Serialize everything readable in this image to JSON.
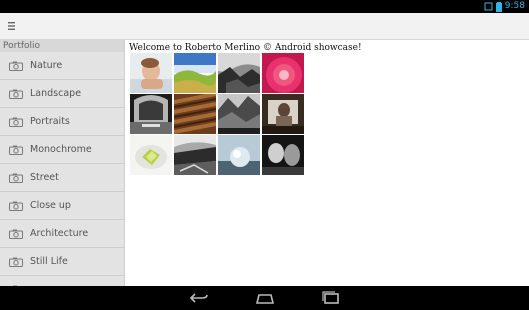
{
  "status": {
    "time": "9:58"
  },
  "sidebar": {
    "header": "Portfolio",
    "items": [
      {
        "label": "Nature"
      },
      {
        "label": "Landscape"
      },
      {
        "label": "Portraits"
      },
      {
        "label": "Monochrome"
      },
      {
        "label": "Street"
      },
      {
        "label": "Close up"
      },
      {
        "label": "Architecture"
      },
      {
        "label": "Still Life"
      }
    ]
  },
  "main": {
    "welcome": "Welcome to Roberto Merlino © Android showcase!",
    "thumbnails": [
      {
        "name": "thumb-child-portrait"
      },
      {
        "name": "thumb-green-hills"
      },
      {
        "name": "thumb-bw-cliffs"
      },
      {
        "name": "thumb-red-flower"
      },
      {
        "name": "thumb-bw-station"
      },
      {
        "name": "thumb-brown-texture"
      },
      {
        "name": "thumb-bw-rocks"
      },
      {
        "name": "thumb-interior"
      },
      {
        "name": "thumb-white-plate"
      },
      {
        "name": "thumb-bw-landscape"
      },
      {
        "name": "thumb-sphere"
      },
      {
        "name": "thumb-dark-still"
      }
    ]
  },
  "colors": {
    "accent": "#33b5e5",
    "sidebar_bg": "#e3e3e3",
    "actionbar_bg": "#f2f2f2"
  }
}
